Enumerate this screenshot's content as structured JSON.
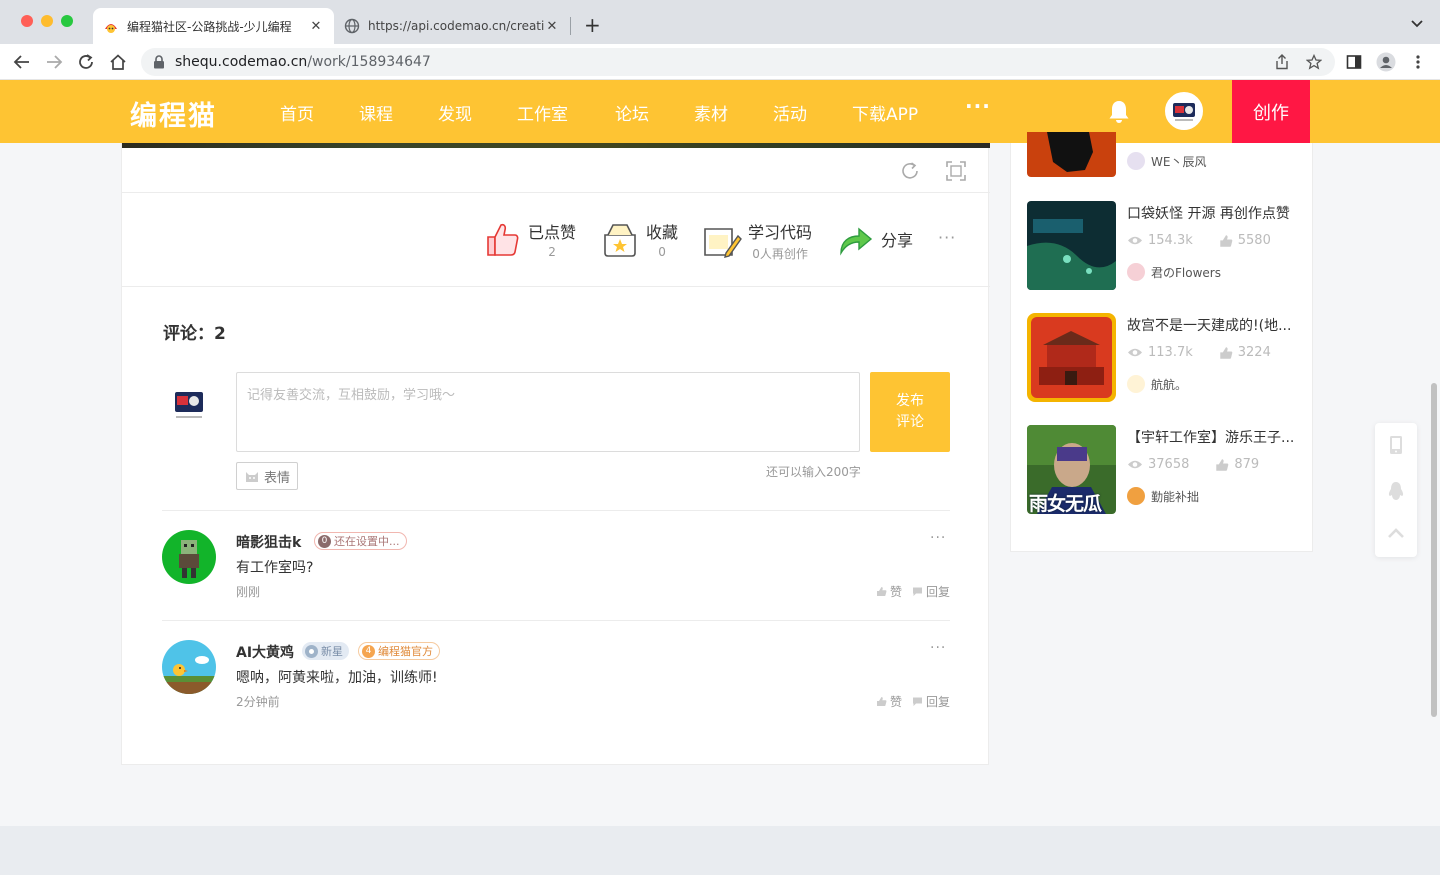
{
  "browser": {
    "tabs": [
      {
        "title": "编程猫社区-公路挑战-少儿编程",
        "close": "✕"
      },
      {
        "title": "https://api.codemao.cn/creation",
        "close": "✕"
      }
    ],
    "new_tab": "+",
    "url_host": "shequ.codemao.cn",
    "url_path": "/work/158934647"
  },
  "header": {
    "logo": "编程猫",
    "nav": [
      "首页",
      "课程",
      "发现",
      "工作室",
      "论坛",
      "素材",
      "活动",
      "下载APP"
    ],
    "more": "···",
    "create": "创作",
    "accent": "#fec433",
    "create_color": "#ff1744"
  },
  "actions": {
    "liked": {
      "label": "已点赞",
      "count": "2"
    },
    "favorite": {
      "label": "收藏",
      "count": "0"
    },
    "study": {
      "label": "学习代码",
      "sub": "0人再创作"
    },
    "share": {
      "label": "分享"
    },
    "more": "···"
  },
  "comments": {
    "title": "评论：2",
    "placeholder": "记得友善交流，互相鼓励，学习哦～",
    "post_button": "发布\n评论",
    "emoji_button": "表情",
    "char_limit": "还可以输入200字",
    "list": [
      {
        "name": "暗影狙击k",
        "badges": [
          {
            "num": "0",
            "text": "还在设置中..."
          }
        ],
        "text": "有工作室吗?",
        "time": "刚刚",
        "like": "赞",
        "reply": "回复",
        "more": "···"
      },
      {
        "name": "AI大黄鸡",
        "badges": [
          {
            "num": "",
            "text": "新星"
          },
          {
            "num": "4",
            "text": "编程猫官方"
          }
        ],
        "text": "嗯呐，阿黄来啦，加油，训练师!",
        "time": "2分钟前",
        "like": "赞",
        "reply": "回复",
        "more": "···"
      }
    ]
  },
  "sidebar": {
    "items": [
      {
        "title": "",
        "views": "",
        "likes": "",
        "author": "WE丶辰风"
      },
      {
        "title": "口袋妖怪 开源 再创作点赞",
        "views": "154.3k",
        "likes": "5580",
        "author": "君のFlowers"
      },
      {
        "title": "故宫不是一天建成的!(地...",
        "views": "113.7k",
        "likes": "3224",
        "author": "航航。"
      },
      {
        "title": "【宇轩工作室】游乐王子...",
        "views": "37658",
        "likes": "879",
        "author": "勤能补拙"
      }
    ],
    "thumb4_caption": "雨女无瓜"
  }
}
